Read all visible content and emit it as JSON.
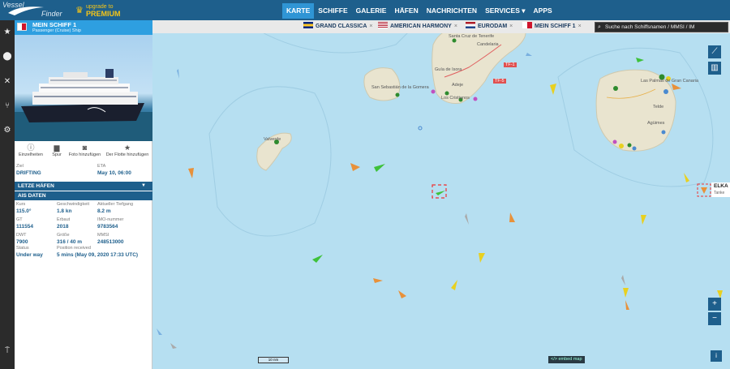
{
  "brand": {
    "line1": "Vessel",
    "line2": "Finder"
  },
  "premium": {
    "line1": "upgrade to",
    "line2": "PREMIUM"
  },
  "nav": [
    {
      "label": "KARTE",
      "active": true
    },
    {
      "label": "SCHIFFE"
    },
    {
      "label": "GALERIE"
    },
    {
      "label": "HÄFEN"
    },
    {
      "label": "NACHRICHTEN"
    },
    {
      "label": "SERVICES ▾"
    },
    {
      "label": "APPS"
    }
  ],
  "vessel": {
    "name": "MEIN SCHIFF 1",
    "type": "Passenger (Cruise) Ship",
    "actions": [
      "Einzelheiten",
      "Spur",
      "Foto hinzufügen",
      "Der Flotte hinzufügen"
    ],
    "ziel_label": "Ziel",
    "ziel": "DRIFTING",
    "eta_label": "ETA",
    "eta": "May 10, 06:00",
    "section_ports": "LETZE HÄFEN",
    "section_ais": "AIS DATEN",
    "ais": {
      "kurs_label": "Kurs",
      "kurs": "115.0°",
      "speed_label": "Geschwindigkeit",
      "speed": "1.8 kn",
      "draft_label": "Aktueller Tiefgang",
      "draft": "8.2 m",
      "gt_label": "GT",
      "gt": "111554",
      "built_label": "Erbaut",
      "built": "2018",
      "imo_label": "IMO-nummer",
      "imo": "9783564",
      "dwt_label": "DWT",
      "dwt": "7900",
      "size_label": "Größe",
      "size": "316 / 40 m",
      "mmsi_label": "MMSI",
      "mmsi": "248513000",
      "received_label": "Position received",
      "status_label": "Status",
      "status": "Under way",
      "received": "5 mins (May 09, 2020 17:33 UTC)"
    }
  },
  "tabs": [
    {
      "label": "GRAND CLASSICA"
    },
    {
      "label": "AMERICAN HARMONY"
    },
    {
      "label": "EURODAM"
    },
    {
      "label": "MEIN SCHIFF 1"
    }
  ],
  "search": {
    "placeholder": "Suche nach Schiffsnamen / MMSI / IM"
  },
  "map": {
    "places": {
      "santa_cruz": "Santa Cruz de Tenerife",
      "candelaria": "Candelaria",
      "guia": "Guía de Isora",
      "adeje": "Adeje",
      "cristianos": "Los Cristianos",
      "san_sebastian": "San Sebastián de la Gomera",
      "valverde": "Valverde",
      "las_palmas": "Las Palmas de Gran Canaria",
      "telde": "Telde",
      "aguimes": "Agüimes"
    },
    "road_label": "TF-1",
    "road_label2": "TF-5",
    "scale": "10 nm",
    "embed": "</> embed map",
    "elka_name": "ELKA",
    "elka_type": "Tanke",
    "zoom_in": "+",
    "zoom_out": "−",
    "info": "i"
  }
}
